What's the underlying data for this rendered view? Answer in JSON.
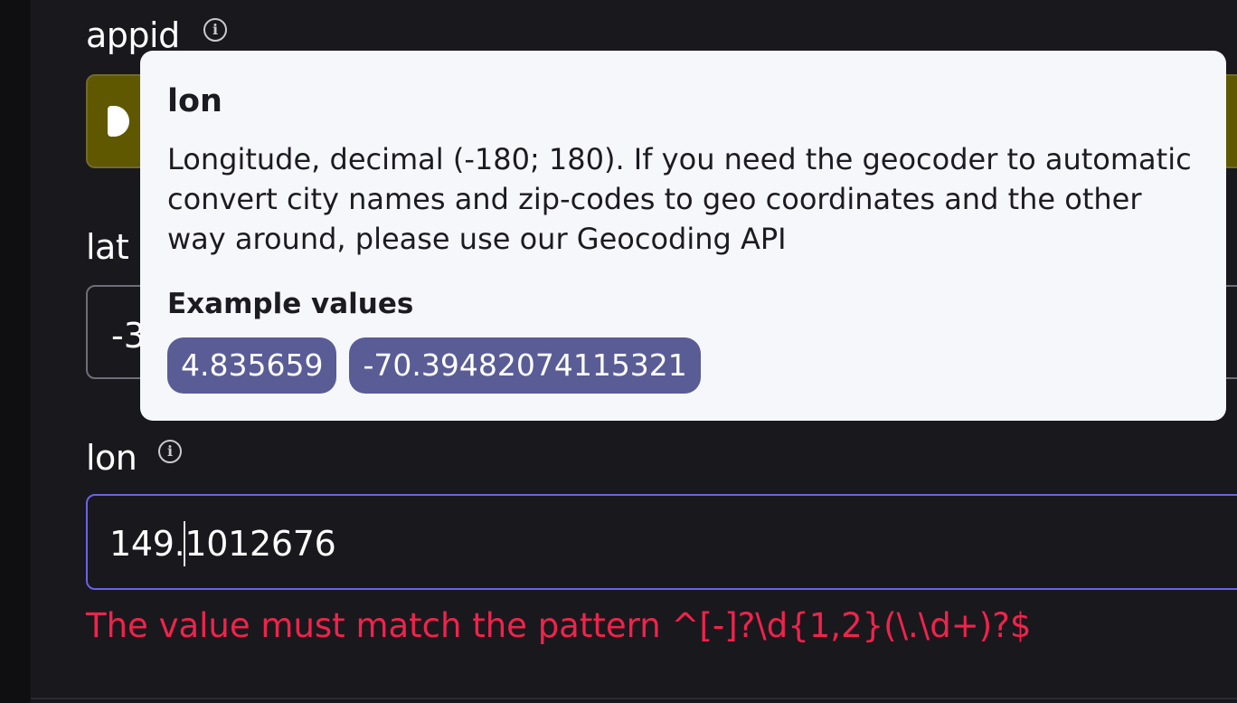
{
  "form": {
    "appid": {
      "label": "appid"
    },
    "lat": {
      "label": "lat",
      "value_visible": "-3"
    },
    "lon": {
      "label": "lon",
      "value": "149.1012676"
    },
    "error": "The value must match the pattern ^[-]?\\d{1,2}(\\.\\d+)?$"
  },
  "tooltip": {
    "title": "lon",
    "description": "Longitude, decimal (-180; 180). If you need the geocoder to automatic convert city names and zip-codes to geo coordinates and the other way around, please use our Geocoding API",
    "examples_title": "Example values",
    "examples": [
      "4.835659",
      "-70.39482074115321"
    ]
  },
  "icons": {
    "info": "info-icon",
    "info_glyph": "i"
  },
  "colors": {
    "accent": "#6a63e6",
    "error": "#f0234c",
    "chip": "#5a5c96"
  }
}
